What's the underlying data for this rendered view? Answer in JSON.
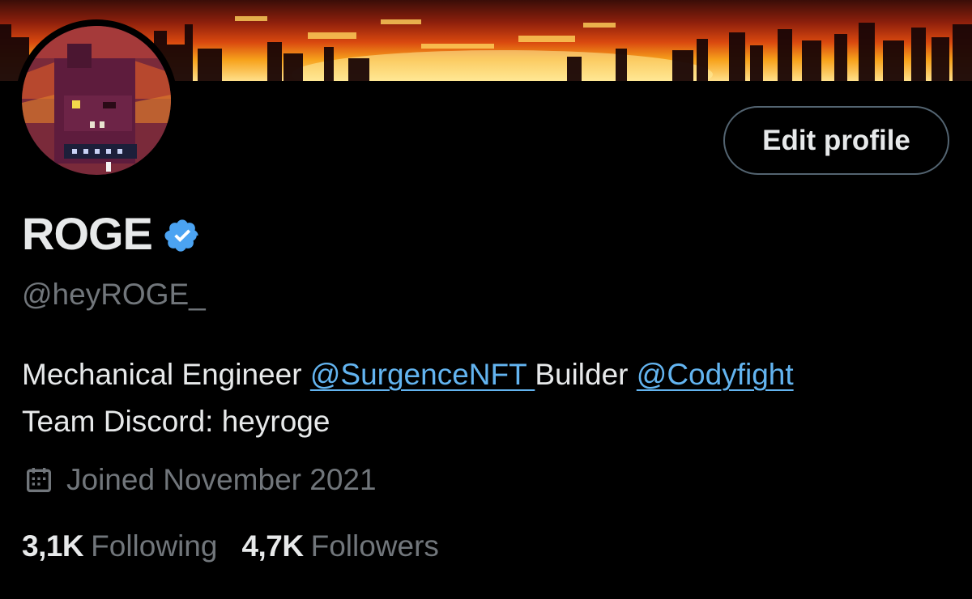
{
  "profile": {
    "display_name": "ROGE",
    "handle": "@heyROGE_",
    "verified_icon": "verified-badge-icon",
    "edit_profile_label": "Edit profile",
    "bio": {
      "part1": "Mechanical Engineer ",
      "mention1": "@SurgenceNFT ",
      "part2": "Builder ",
      "mention2": "@Codyfight",
      "line2": "Team Discord: heyroge"
    },
    "joined": "Joined November 2021",
    "stats": {
      "following_count": "3,1K",
      "following_label": "Following",
      "followers_count": "4,7K",
      "followers_label": "Followers"
    }
  },
  "colors": {
    "background": "#000000",
    "text_primary": "#e7e9ea",
    "text_secondary": "#71767b",
    "link": "#63b4f0",
    "verified": "#4ba3f2",
    "button_border": "#536471"
  }
}
